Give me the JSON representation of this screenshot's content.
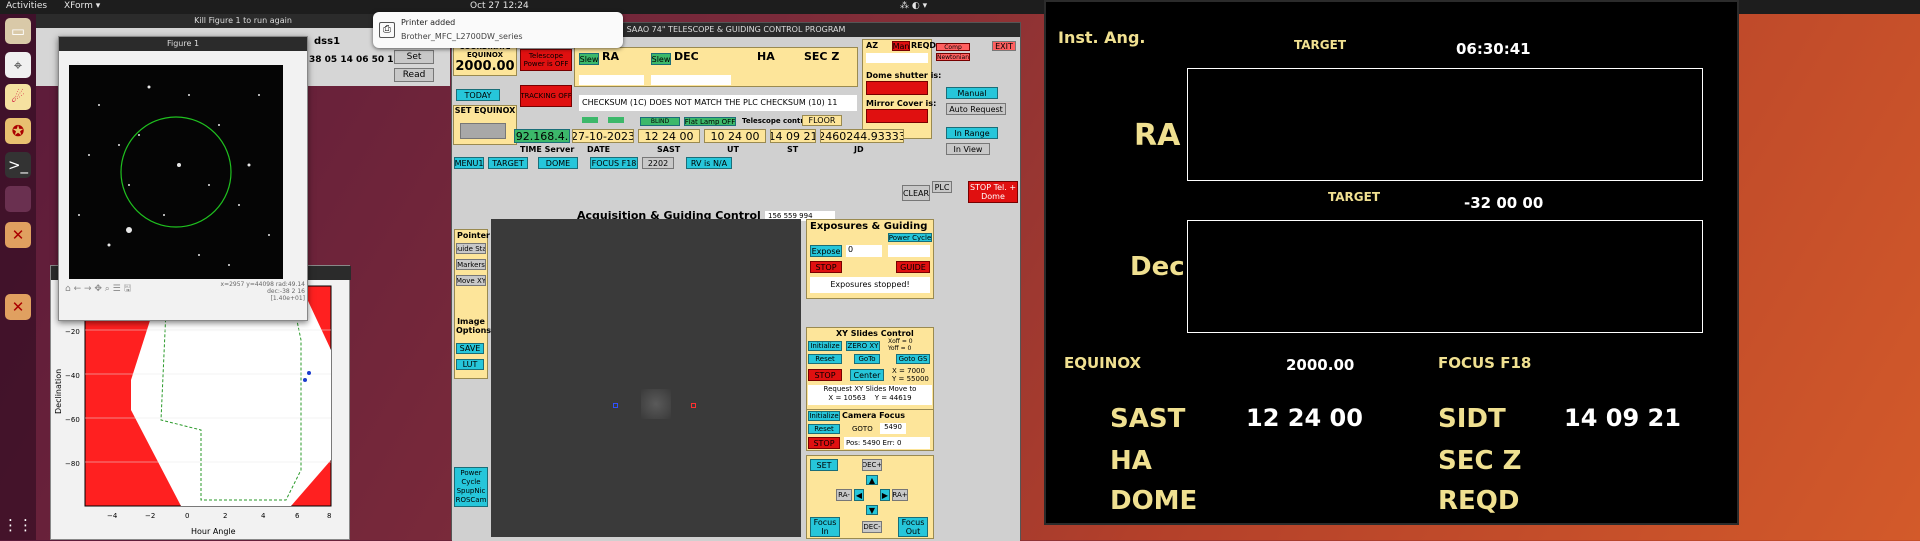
{
  "topbar": {
    "activities": "Activities",
    "app_menu": "XForm ▾",
    "clock": "Oct 27  12:24",
    "tray": "⁂ ◐ ▾"
  },
  "notification": {
    "title": "Printer added",
    "body": "Brother_MFC_L2700DW_series"
  },
  "xform": {
    "title": "Kill Figure 1 to run again",
    "field_label": "dss1",
    "coords": "38 05 14 06 50 17 -",
    "set_label": "Set",
    "read_label": "Read"
  },
  "figure1": {
    "title": "Figure 1",
    "status": "x=2957 y=44098 rad:49.14\ndec:-38 2 16\n[1.40e+01]"
  },
  "figure2": {
    "title": "",
    "ylabel": "Declination",
    "xlabel": "Hour Angle",
    "yticks": [
      "0",
      "−20",
      "−40",
      "−60",
      "−80"
    ],
    "xticks": [
      "−4",
      "−2",
      "0",
      "2",
      "4",
      "6",
      "8"
    ]
  },
  "saao": {
    "title": "SAAO 74\" TELESCOPE & GUIDING CONTROL PROGRAM",
    "coord_label": "COORDINATE EQUINOX",
    "equinox": "2000.00",
    "today": "TODAY",
    "set_equinox": "SET EQUINOX",
    "tel_power": "Telescope Power is OFF",
    "tracking": "TRACKING OFF",
    "slew1": "Slew",
    "ra": "RA",
    "slew2": "Slew",
    "dec": "DEC",
    "ha": "HA",
    "secz": "SEC Z",
    "checksum": "CHECKSUM (1C) DOES NOT MATCH THE PLC CHECKSUM (10) 11",
    "az": "AZ",
    "man": "Man",
    "reqd": "REQD",
    "comp": "Comp",
    "newtonian": "Newtonian",
    "exit": "EXIT",
    "dome_shutter": "Dome shutter is:",
    "mirror_cover": "Mirror Cover is:",
    "manual": "Manual",
    "auto_request": "Auto Request",
    "in_range": "In Range",
    "in_view": "In View",
    "blind": "BLIND",
    "flat_lamp": "Flat Lamp OFF",
    "tele_ctrl": "Telescope control is:",
    "floor": "FLOOR",
    "ip": "192.168.4.5",
    "date": "27-10-2023",
    "sast": "12 24 00",
    "ut": "10 24 00",
    "st": "14 09 21",
    "jd": "2460244.93333",
    "time_server": "TIME Server",
    "date_lbl": "DATE",
    "sast_lbl": "SAST",
    "ut_lbl": "UT",
    "st_lbl": "ST",
    "jd_lbl": "JD",
    "menu1": "MENU1",
    "target": "TARGET",
    "dome": "DOME",
    "focus": "FOCUS F18",
    "focus_val": "2202",
    "rv": "RV is N/A",
    "clear": "CLEAR",
    "plc": "PLC",
    "stop_tel": "STOP Tel. + Dome",
    "acq_title": "Acquisition & Guiding Control",
    "acq_field": "156 559 994",
    "pointer": "Pointer",
    "guide_star": "Guide Star",
    "markers": "Markers",
    "move_xy": "Move XY",
    "image_options": "Image Options",
    "save": "SAVE",
    "lut": "LUT",
    "power_cycle": "Power Cycle SpupNic ROSCam",
    "exp_title": "Exposures & Guiding",
    "exp_power": "Power Cycle",
    "expose": "Expose",
    "exp_val": "0",
    "exp_stop": "STOP",
    "guide": "GUIDE",
    "exp_stopped": "Exposures stopped!",
    "xy_title": "XY Slides Control",
    "initialize": "Initialize",
    "zero_xy": "ZERO XY",
    "xoff": "Xoff = 0",
    "yoff": "Yoff = 0",
    "reset": "Reset",
    "goto": "GoTo",
    "goto_gs": "Goto GS",
    "stop": "STOP",
    "center": "Center",
    "x_val": "X = 7000",
    "y_val": "Y = 55000",
    "xy_request": "Request XY Slides Move to\nX = 10563    Y = 44619",
    "cam_title": "Camera Focus",
    "cam_init": "Initialize",
    "cam_reset": "Reset",
    "cam_goto": "GOTO",
    "cam_goto_val": "5490",
    "cam_stop": "STOP",
    "cam_pos": "Pos: 5490  Err: 0",
    "pad_set": "SET",
    "pad_decp": "DEC+",
    "pad_ram": "RA-",
    "pad_rap": "RA+",
    "pad_decm": "DEC-",
    "focus_in": "Focus In",
    "focus_out": "Focus Out"
  },
  "display": {
    "inst_ang": "Inst. Ang.",
    "target1": "TARGET",
    "time": "06:30:41",
    "ra": "RA",
    "target2": "TARGET",
    "dec_val": "-32 00 00",
    "dec": "Dec",
    "equinox_lbl": "EQUINOX",
    "equinox_val": "2000.00",
    "focus_lbl": "FOCUS F18",
    "sast_lbl": "SAST",
    "sast_val": "12 24 00",
    "sidt_lbl": "SIDT",
    "sidt_val": "14 09 21",
    "ha_lbl": "HA",
    "secz_lbl": "SEC Z",
    "dome_lbl": "DOME",
    "reqd_lbl": "REQD"
  },
  "colors": {
    "display_yellow": "#f0e090",
    "panel_yellow": "#fde59a",
    "button_cyan": "#26c6da",
    "alert_red": "#e01010"
  },
  "dock_icons": [
    "files-icon",
    "telescope-icon",
    "comet-icon",
    "media-icon",
    "terminal-icon",
    "app-icon",
    "ubuntu-icon",
    "ubuntu-icon-2",
    "grid-icon"
  ]
}
